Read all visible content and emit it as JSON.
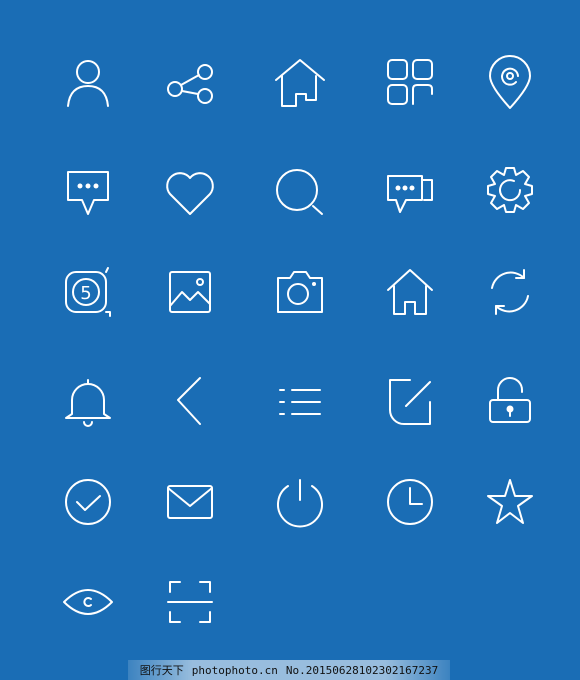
{
  "background_color": "#1a6db5",
  "icon_color": "#ffffff",
  "icons": [
    "user-icon",
    "share-icon",
    "home-icon",
    "grid-apps-icon",
    "location-pin-icon",
    "chat-bubble-icon",
    "heart-icon",
    "search-icon",
    "chat-bubbles-icon",
    "gear-icon",
    "timer-5-icon",
    "image-icon",
    "camera-icon",
    "house-icon",
    "refresh-icon",
    "bell-icon",
    "back-chevron-icon",
    "list-icon",
    "edit-icon",
    "unlock-icon",
    "check-circle-icon",
    "mail-icon",
    "power-icon",
    "clock-icon",
    "star-icon",
    "eye-icon",
    "scan-icon"
  ],
  "timer_digit": "5",
  "watermark": {
    "brand": "图行天下",
    "site": "photophoto.cn",
    "number": "No.20150628102302167237"
  }
}
